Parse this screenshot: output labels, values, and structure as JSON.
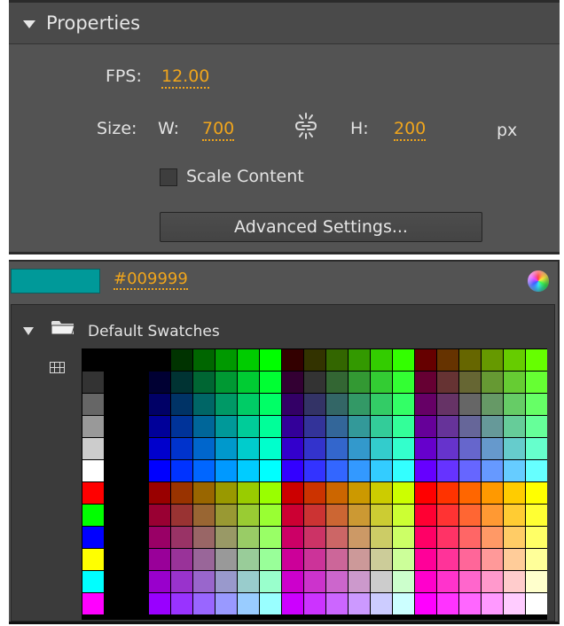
{
  "properties": {
    "title": "Properties",
    "fps_label": "FPS:",
    "fps_value": "12.00",
    "size_label": "Size:",
    "width_label": "W:",
    "width_value": "700",
    "height_label": "H:",
    "height_value": "200",
    "unit": "px",
    "scale_content_label": "Scale Content",
    "scale_content_checked": false,
    "advanced_button": "Advanced Settings..."
  },
  "swatches": {
    "current_color": "#009999",
    "hex_value": "#009999",
    "group_name": "Default Swatches",
    "side_colors": [
      "#000000",
      "#333333",
      "#666666",
      "#999999",
      "#CCCCCC",
      "#FFFFFF",
      "#FF0000",
      "#00FF00",
      "#0000FF",
      "#FFFF00",
      "#00FFFF",
      "#FF00FF"
    ]
  },
  "colors": {
    "panel_bg": "#535353",
    "accent": "#f0a51c",
    "text": "#e3e3e3"
  },
  "icons": [
    "disclosure-triangle-icon",
    "chain-link-icon",
    "folder-icon",
    "grid-view-icon",
    "color-wheel-icon"
  ]
}
